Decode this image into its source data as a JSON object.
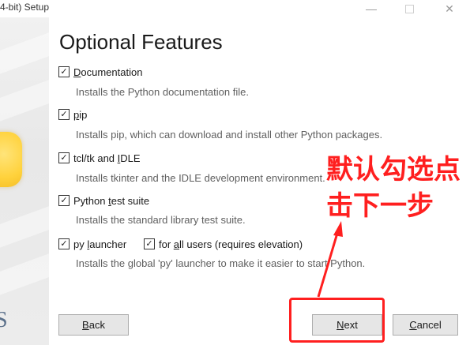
{
  "window": {
    "title": "4-bit) Setup",
    "minimize_glyph": "—",
    "close_glyph": "✕"
  },
  "page": {
    "title": "Optional Features"
  },
  "options": [
    {
      "label_pre": "",
      "label_u": "D",
      "label_post": "ocumentation",
      "checked": true,
      "description": "Installs the Python documentation file."
    },
    {
      "label_pre": "",
      "label_u": "p",
      "label_post": "ip",
      "checked": true,
      "description": "Installs pip, which can download and install other Python packages."
    },
    {
      "label_pre": "tcl/tk and ",
      "label_u": "I",
      "label_post": "DLE",
      "checked": true,
      "description": "Installs tkinter and the IDLE development environment."
    },
    {
      "label_pre": "Python ",
      "label_u": "t",
      "label_post": "est suite",
      "checked": true,
      "description": "Installs the standard library test suite."
    },
    {
      "label_pre": "py ",
      "label_u": "l",
      "label_post": "auncher",
      "checked": true,
      "description": "Installs the global 'py' launcher to make it easier to start Python."
    }
  ],
  "for_all_users": {
    "label_pre": "for ",
    "label_u": "a",
    "label_post": "ll users (requires elevation)",
    "checked": true
  },
  "check_glyph": "✓",
  "buttons": {
    "back": {
      "u": "B",
      "rest": "ack"
    },
    "next": {
      "u": "N",
      "rest": "ext"
    },
    "cancel": {
      "u": "C",
      "rest": "ancel"
    }
  },
  "annotation": {
    "line1": "默认勾选点",
    "line2": "击下一步",
    "color": "#ff1f1f"
  }
}
